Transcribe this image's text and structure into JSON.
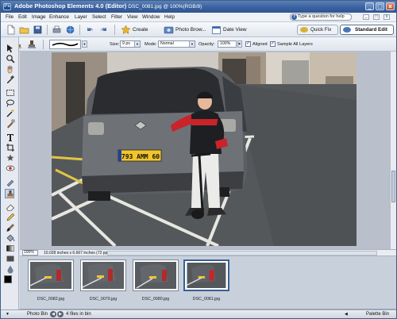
{
  "window": {
    "app_title": "Adobe Photoshop Elements 4.0 (Editor)",
    "document_title": "DSC_0081.jpg @ 100%(RGB/8)",
    "controls": {
      "minimize": "_",
      "maximize": "□",
      "close": "x"
    }
  },
  "menubar": {
    "items": [
      "File",
      "Edit",
      "Image",
      "Enhance",
      "Layer",
      "Select",
      "Filter",
      "View",
      "Window",
      "Help"
    ],
    "help_placeholder": "Type a question for help",
    "mini_controls": [
      "_",
      "□",
      "x"
    ]
  },
  "shortcuts": {
    "create_label": "Create",
    "photo_browser_label": "Photo Brow...",
    "date_view_label": "Date View",
    "quick_fix_label": "Quick Fix",
    "standard_edit_label": "Standard Edit"
  },
  "options": {
    "size_label": "Size:",
    "size_value": "9 px",
    "mode_label": "Mode:",
    "mode_value": "Normal",
    "opacity_label": "Opacity:",
    "opacity_value": "100%",
    "aligned_label": "Aligned",
    "aligned_checked": true,
    "sample_all_layers_label": "Sample All Layers",
    "sample_all_layers_checked": true
  },
  "canvas": {
    "license_plate": "793 AMM 60"
  },
  "statusbar": {
    "zoom": "100%",
    "doc_info": "10.028 inches x 6.667 inches (72 ppi)"
  },
  "photobin": {
    "thumbnails": [
      {
        "label": "DSC_0082.jpg",
        "selected": false
      },
      {
        "label": "DSC_0079.jpg",
        "selected": false
      },
      {
        "label": "DSC_0080.jpg",
        "selected": false
      },
      {
        "label": "DSC_0081.jpg",
        "selected": true
      }
    ]
  },
  "bottombar": {
    "photo_bin_label": "Photo Bin",
    "files_in_bin": "4 files in bin",
    "palette_bin_label": "Palette Bin"
  },
  "colors": {
    "titlebar": "#3b62a0",
    "car_body": "#5b5e63",
    "jacket_red": "#c8242a",
    "plate_yellow": "#f2c52a"
  }
}
